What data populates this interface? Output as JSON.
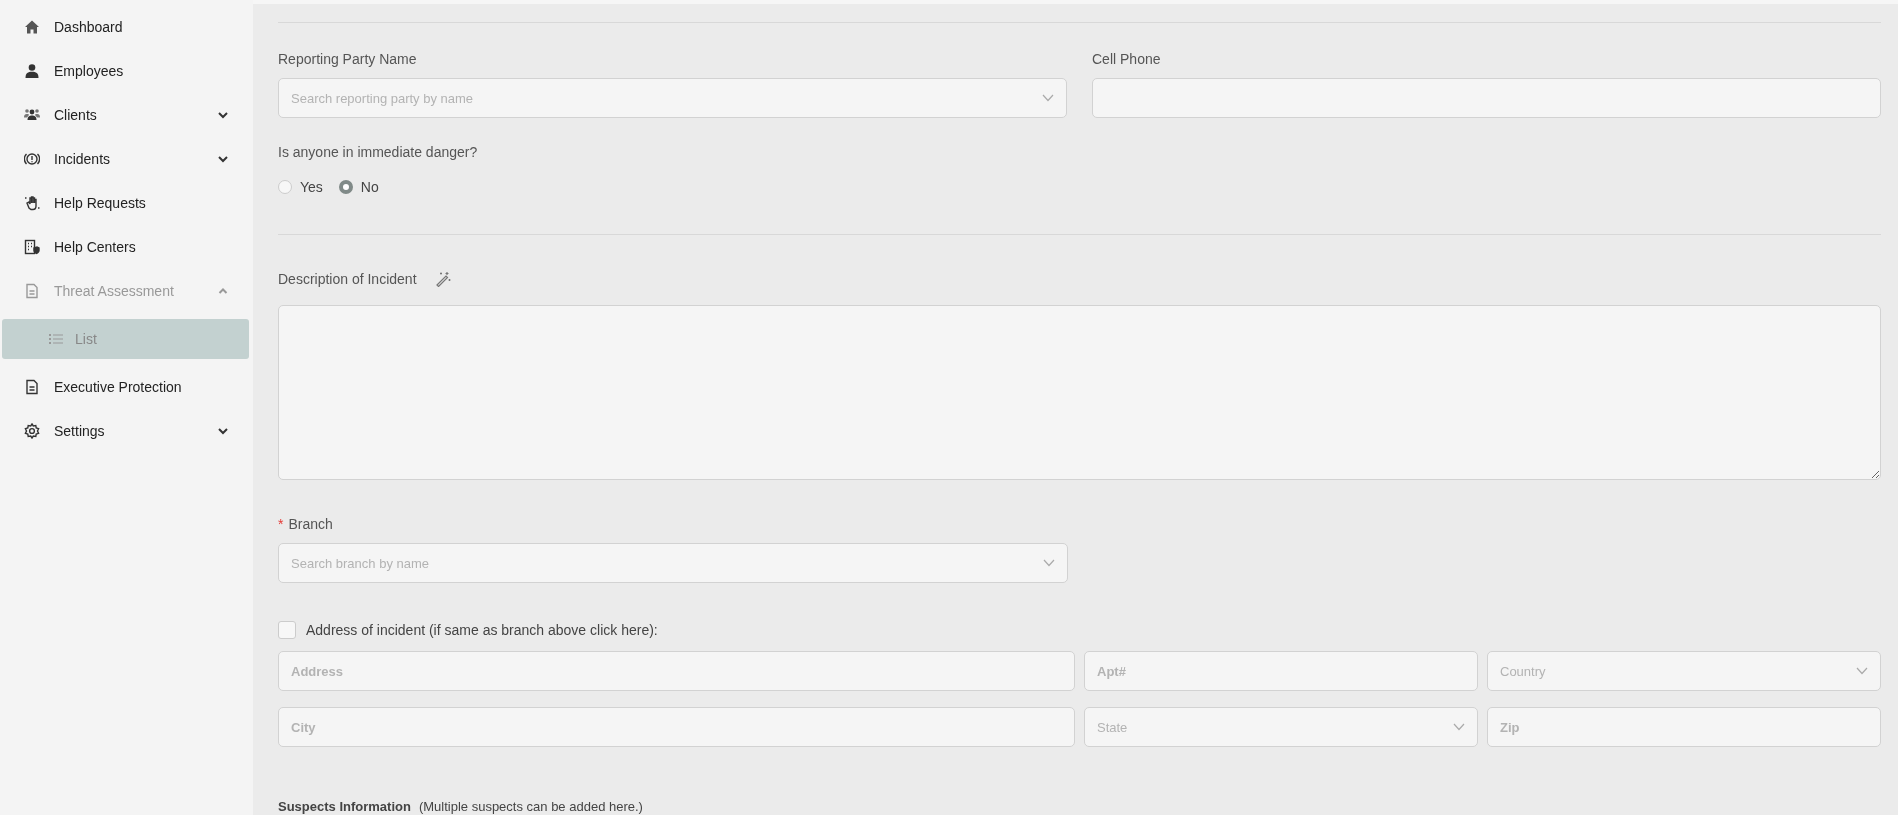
{
  "sidebar": {
    "items": [
      {
        "label": "Dashboard"
      },
      {
        "label": "Employees"
      },
      {
        "label": "Clients",
        "expanded": false
      },
      {
        "label": "Incidents",
        "expanded": false
      },
      {
        "label": "Help Requests"
      },
      {
        "label": "Help Centers"
      },
      {
        "label": "Threat Assessment",
        "expanded": true,
        "children": [
          {
            "label": "List",
            "selected": true
          }
        ]
      },
      {
        "label": "Executive Protection"
      },
      {
        "label": "Settings",
        "expanded": false
      }
    ]
  },
  "form": {
    "reporting_party": {
      "label": "Reporting Party Name",
      "placeholder": "Search reporting party by name"
    },
    "cell_phone": {
      "label": "Cell Phone"
    },
    "danger": {
      "question": "Is anyone in immediate danger?",
      "options": [
        {
          "label": "Yes",
          "selected": false
        },
        {
          "label": "No",
          "selected": true
        }
      ]
    },
    "description": {
      "label": "Description of Incident"
    },
    "branch": {
      "required_mark": "*",
      "label": "Branch",
      "placeholder": "Search branch by name"
    },
    "same_address": {
      "label": "Address of incident (if same as branch above click here):",
      "checked": false
    },
    "address_rows": [
      [
        {
          "kind": "input",
          "placeholder": "Address"
        },
        {
          "kind": "input",
          "placeholder": "Apt#"
        },
        {
          "kind": "select",
          "placeholder": "Country"
        }
      ],
      [
        {
          "kind": "input",
          "placeholder": "City"
        },
        {
          "kind": "select",
          "placeholder": "State"
        },
        {
          "kind": "input",
          "placeholder": "Zip"
        }
      ]
    ],
    "suspects": {
      "title": "Suspects Information",
      "note": "(Multiple suspects can be added here.)"
    }
  }
}
